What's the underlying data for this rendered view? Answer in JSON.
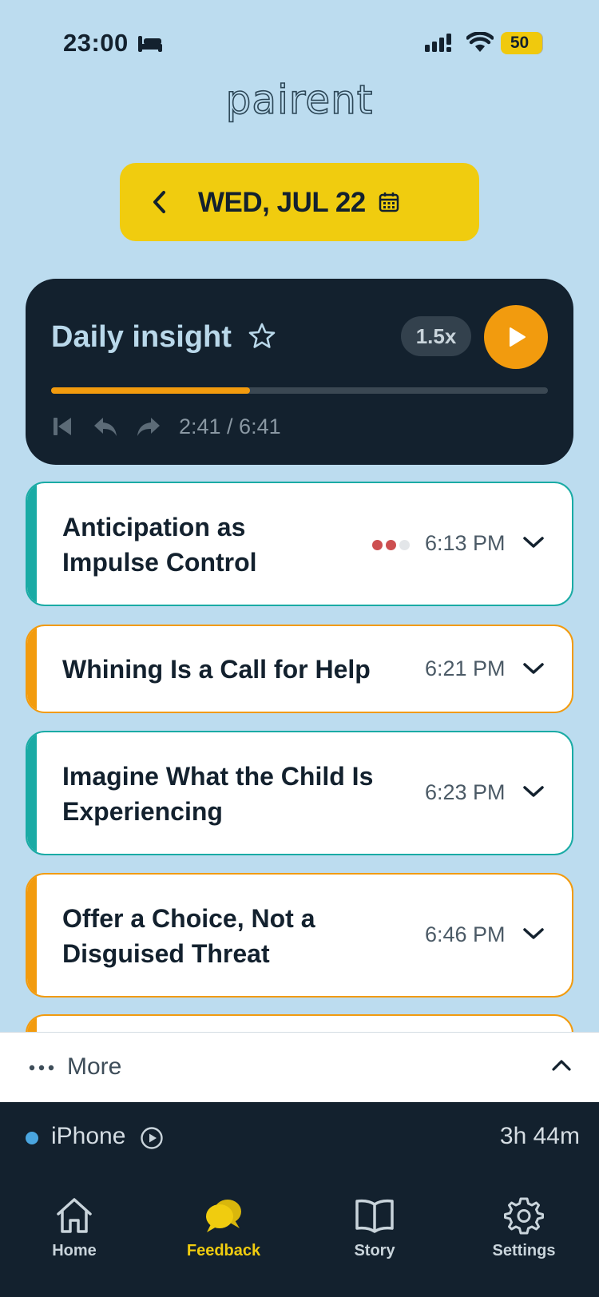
{
  "status_bar": {
    "time": "23:00",
    "battery": "50"
  },
  "logo": "pairent",
  "date_nav": {
    "label": "WED, JUL 22"
  },
  "insight": {
    "title": "Daily insight",
    "speed": "1.5x",
    "progress": 0.4,
    "time_readout": "2:41 / 6:41"
  },
  "list": [
    {
      "title_lines": [
        "Anticipation as",
        "Impulse Control"
      ],
      "time": "6:13 PM",
      "accent": "#1aaba5",
      "rating": [
        true,
        true,
        false
      ]
    },
    {
      "title_lines": [
        "Whining Is a Call for Help"
      ],
      "time": "6:21 PM",
      "accent": "#f29b0e"
    },
    {
      "title_lines": [
        "Imagine What the Child Is",
        "Experiencing"
      ],
      "time": "6:23 PM",
      "accent": "#1aaba5"
    },
    {
      "title_lines": [
        "Offer a Choice, Not a",
        "Disguised Threat"
      ],
      "time": "6:46 PM",
      "accent": "#f29b0e"
    }
  ],
  "more": {
    "label": "More"
  },
  "device": {
    "name": "iPhone",
    "duration": "3h 44m"
  },
  "tabs": [
    {
      "label": "Home",
      "icon": "home-icon"
    },
    {
      "label": "Feedback",
      "icon": "chat-bubbles-icon",
      "active": true
    },
    {
      "label": "Story",
      "icon": "book-icon"
    },
    {
      "label": "Settings",
      "icon": "gear-icon"
    }
  ],
  "colors": {
    "background": "#bcdcef",
    "dark": "#13212e",
    "yellow": "#f0cc0f",
    "orange": "#f29b0e",
    "teal": "#1aaba5"
  }
}
